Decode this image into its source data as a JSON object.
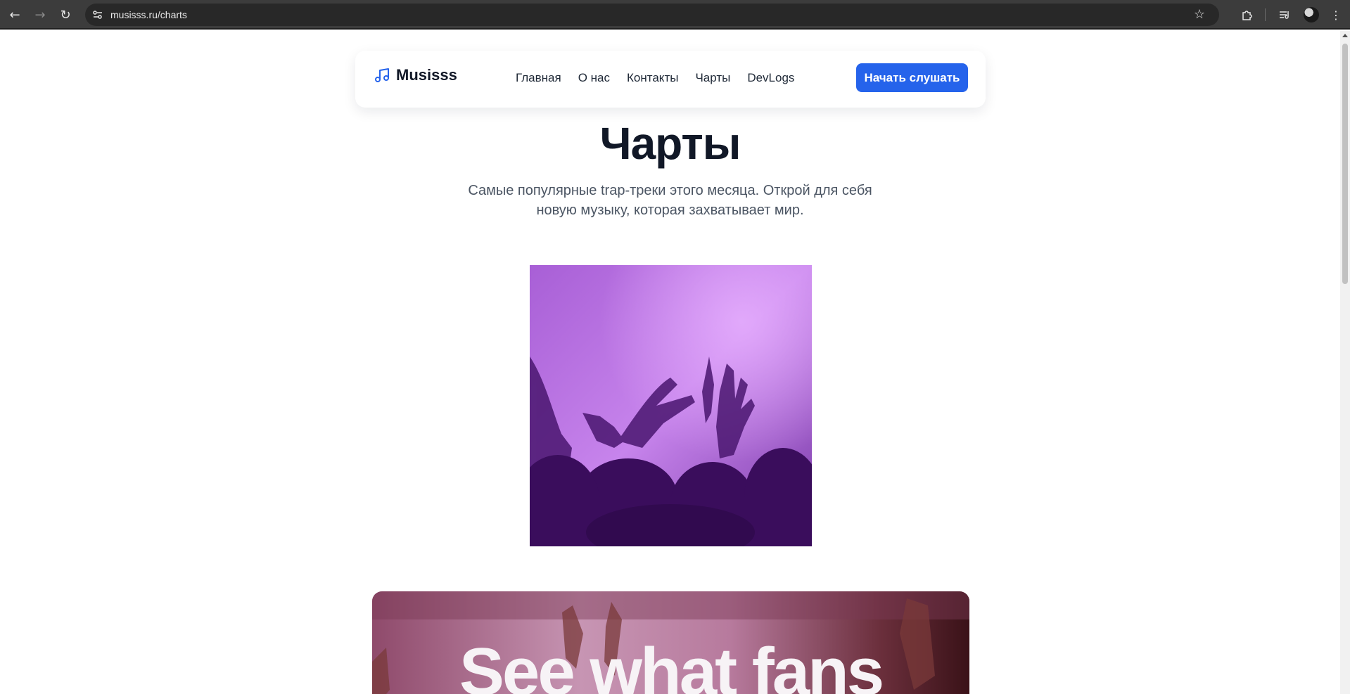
{
  "browser": {
    "url": "musisss.ru/charts",
    "icons": {
      "back": "arrow-left-icon",
      "forward": "arrow-right-icon",
      "reload": "reload-icon",
      "site_info": "site-settings-icon",
      "bookmark": "star-icon",
      "extensions": "puzzle-icon",
      "media": "media-queue-icon",
      "menu": "more-vertical-icon"
    }
  },
  "header": {
    "logo_text": "Musisss",
    "logo_icon": "music-note-icon",
    "nav": [
      "Главная",
      "О нас",
      "Контакты",
      "Чарты",
      "DevLogs"
    ],
    "cta_label": "Начать слушать"
  },
  "hero": {
    "title": "Чарты",
    "subtitle": "Самые популярные trap-треки этого месяца. Открой для себя новую музыку, которая захватывает мир."
  },
  "banner": {
    "text": "See what fans"
  },
  "colors": {
    "accent": "#2563eb",
    "title": "#111827",
    "subtitle": "#4b5563",
    "hero_purple": "#8e4fc2",
    "hero_deep": "#3d0f63"
  }
}
